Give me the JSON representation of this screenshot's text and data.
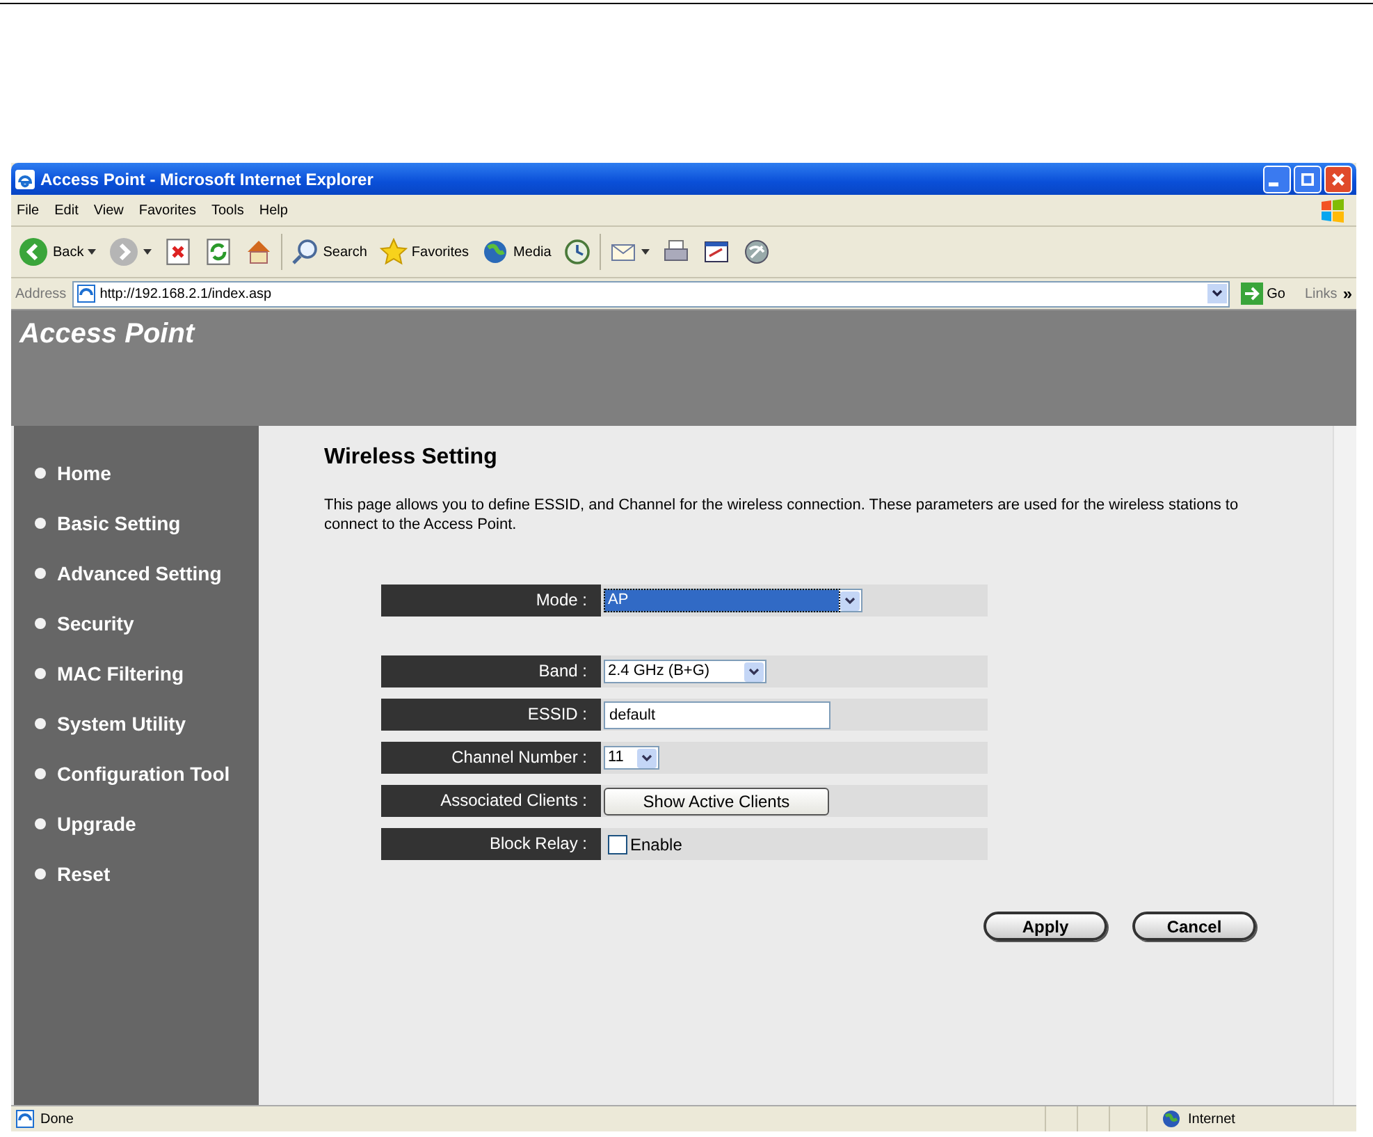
{
  "browser": {
    "title": "Access Point - Microsoft Internet Explorer",
    "menu": [
      "File",
      "Edit",
      "View",
      "Favorites",
      "Tools",
      "Help"
    ],
    "toolbar": [
      {
        "kind": "back",
        "label": "Back",
        "caret": true
      },
      {
        "kind": "forward",
        "caret": true
      },
      {
        "kind": "stop"
      },
      {
        "kind": "refresh"
      },
      {
        "kind": "home"
      },
      {
        "kind": "sep"
      },
      {
        "kind": "search",
        "label": "Search"
      },
      {
        "kind": "favorites",
        "label": "Favorites"
      },
      {
        "kind": "media",
        "label": "Media"
      },
      {
        "kind": "history"
      },
      {
        "kind": "sep"
      },
      {
        "kind": "mail",
        "caret": true
      },
      {
        "kind": "print"
      },
      {
        "kind": "edit"
      },
      {
        "kind": "messenger"
      }
    ],
    "address_label": "Address",
    "url": "http://192.168.2.1/index.asp",
    "go": "Go",
    "links": "Links",
    "links_more": "»"
  },
  "site": {
    "banner": "Access Point",
    "nav": [
      "Home",
      "Basic Setting",
      "Advanced Setting",
      "Security",
      "MAC Filtering",
      "System Utility",
      "Configuration Tool",
      "Upgrade",
      "Reset"
    ]
  },
  "page": {
    "heading": "Wireless Setting",
    "description": "This page allows you to define ESSID, and Channel for the wireless connection. These parameters are used for the wireless stations to connect to the Access Point.",
    "fields": [
      {
        "kind": "select",
        "label": "Mode :",
        "value": "AP",
        "highlighted": true
      },
      {
        "kind": "select",
        "label": "Band :",
        "value": "2.4 GHz (B+G)",
        "highlighted": false
      },
      {
        "kind": "text",
        "label": "ESSID :",
        "value": "default"
      },
      {
        "kind": "select",
        "label": "Channel Number :",
        "value": "11",
        "highlighted": false
      },
      {
        "kind": "button",
        "label": "Associated Clients :",
        "value": "Show Active Clients"
      },
      {
        "kind": "checkbox",
        "label": "Block Relay :",
        "value": "Enable",
        "checked": false
      }
    ],
    "buttons": [
      "Apply",
      "Cancel"
    ]
  },
  "status_bar": {
    "text": "Done",
    "zone": "Internet"
  }
}
